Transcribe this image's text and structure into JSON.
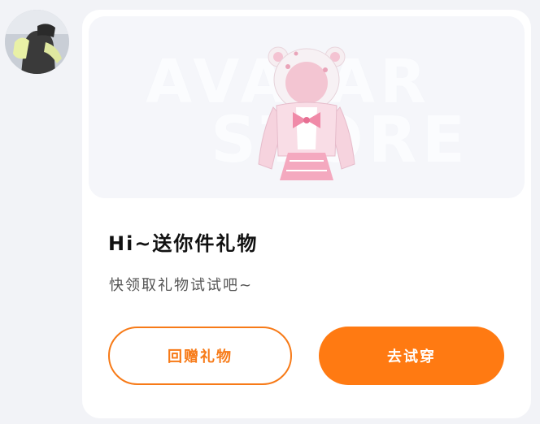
{
  "colors": {
    "accent": "#ff7a12",
    "card_bg": "#ffffff",
    "page_bg": "#f2f3f7"
  },
  "avatar": {
    "icon": "user-avatar-photo"
  },
  "banner": {
    "watermark_line1": "AVATAR",
    "watermark_line2": "STORE",
    "image": "pink-bear-hoodie-outfit"
  },
  "message": {
    "title": "Hi~送你件礼物",
    "subtitle": "快领取礼物试试吧~"
  },
  "actions": {
    "return_gift_label": "回赠礼物",
    "try_on_label": "去试穿"
  }
}
